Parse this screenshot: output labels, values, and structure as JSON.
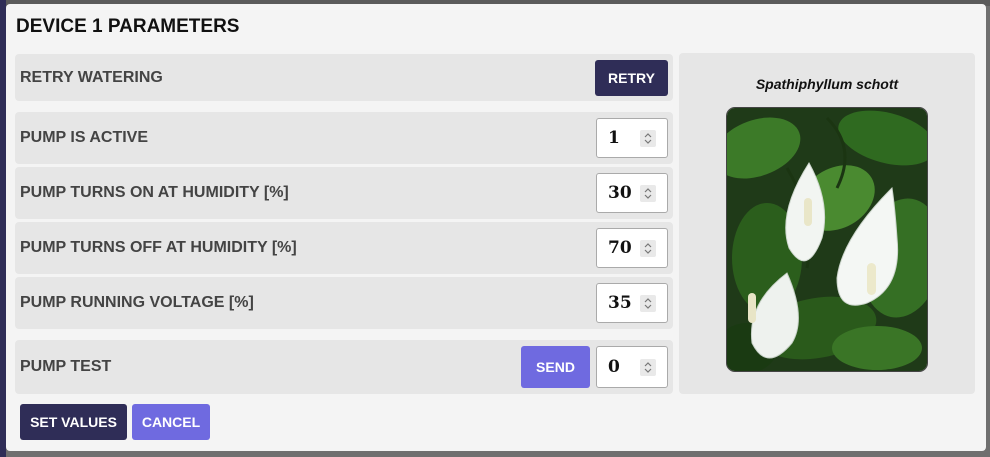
{
  "dialog": {
    "title": "DEVICE 1 PARAMETERS"
  },
  "rows": {
    "retry": {
      "label": "RETRY WATERING",
      "button": "RETRY"
    },
    "pump_active": {
      "label": "PUMP IS ACTIVE",
      "value": "1"
    },
    "on_humidity": {
      "label": "PUMP TURNS ON AT HUMIDITY [%]",
      "value": "30"
    },
    "off_humidity": {
      "label": "PUMP TURNS OFF AT HUMIDITY [%]",
      "value": "70"
    },
    "voltage": {
      "label": "PUMP RUNNING VOLTAGE [%]",
      "value": "35"
    },
    "test": {
      "label": "PUMP TEST",
      "button": "SEND",
      "value": "0"
    }
  },
  "actions": {
    "set_values": "SET VALUES",
    "cancel": "CANCEL"
  },
  "plant": {
    "name": "Spathiphyllum schott",
    "image": "peace-lily-photo"
  },
  "colors": {
    "primary_dark": "#2f2d57",
    "primary_light": "#6f6ae0",
    "row_bg": "#e6e6e6",
    "modal_bg": "#f4f4f4"
  }
}
